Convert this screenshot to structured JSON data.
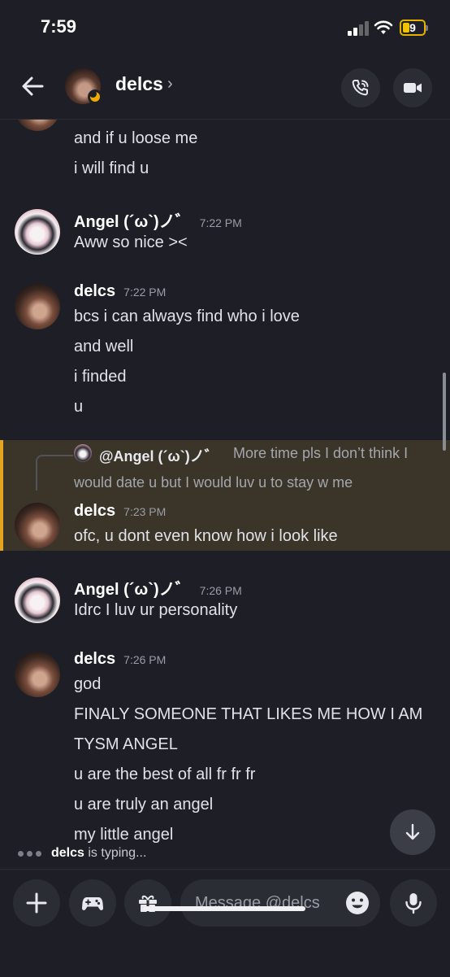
{
  "status_bar": {
    "time": "7:59",
    "battery": "9"
  },
  "header": {
    "name": "delcs",
    "chevron": "›"
  },
  "messages": {
    "m1": {
      "lines": [
        "and if u loose me",
        "i will find u"
      ]
    },
    "m2": {
      "author": "Angel (´ω`)ノ゛",
      "time": "7:22 PM",
      "lines": [
        "Aww so nice ><"
      ]
    },
    "m3": {
      "author": "delcs",
      "time": "7:22 PM",
      "lines": [
        "bcs i can always find who i love",
        "and well",
        "i finded",
        "u"
      ]
    },
    "m4": {
      "reply_author": "@Angel (´ω`)ノ゛",
      "reply_text_1": "More time pls I don’t think I",
      "reply_text_2": "would date u but I would luv u to stay w me",
      "author": "delcs",
      "time": "7:23 PM",
      "lines": [
        "ofc, u dont even know how i look like"
      ]
    },
    "m5": {
      "author": "Angel (´ω`)ノ゛",
      "time": "7:26 PM",
      "lines": [
        "Idrc I luv ur personality"
      ]
    },
    "m6": {
      "author": "delcs",
      "time": "7:26 PM",
      "lines": [
        "god",
        "FINALY SOMEONE THAT LIKES ME HOW I AM",
        "TYSM ANGEL",
        "u are the best of all fr fr fr",
        "u are truly an angel",
        "my little angel"
      ]
    }
  },
  "typing": {
    "user": "delcs",
    "text": "is typing..."
  },
  "composer": {
    "placeholder": "Message @delcs"
  },
  "icons": [
    "back-arrow-icon",
    "phone-call-icon",
    "video-camera-icon",
    "plus-icon",
    "gamepad-icon",
    "gift-icon",
    "emoji-icon",
    "microphone-icon",
    "arrow-down-icon"
  ],
  "colors": {
    "background": "#1e1f26",
    "highlight": "#3a3528",
    "highlight_bar": "#e5a51f",
    "idle_moon": "#f2a900"
  }
}
